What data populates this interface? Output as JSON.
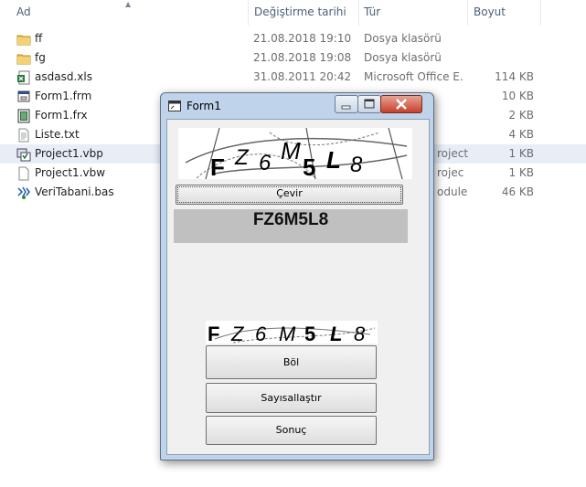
{
  "columns": {
    "name": "Ad",
    "date": "Değiştirme tarihi",
    "type": "Tür",
    "size": "Boyut"
  },
  "files": [
    {
      "icon": "folder-icon",
      "name": "ff",
      "date": "21.08.2018 19:10",
      "type": "Dosya klasörü",
      "size": ""
    },
    {
      "icon": "folder-icon",
      "name": "fg",
      "date": "21.08.2018 19:08",
      "type": "Dosya klasörü",
      "size": ""
    },
    {
      "icon": "excel-file-icon",
      "name": "asdasd.xls",
      "date": "31.08.2011 20:42",
      "type": "Microsoft Office E...",
      "size": "114 KB"
    },
    {
      "icon": "vb-form-icon",
      "name": "Form1.frm",
      "date": "",
      "type": "",
      "size": "10 KB"
    },
    {
      "icon": "vb-binary-icon",
      "name": "Form1.frx",
      "date": "",
      "type": "",
      "size": "2 KB"
    },
    {
      "icon": "text-file-icon",
      "name": "Liste.txt",
      "date": "",
      "type": "",
      "size": "4 KB"
    },
    {
      "icon": "vb-project-icon",
      "name": "Project1.vbp",
      "date": "",
      "type": "roject",
      "size": "1 KB"
    },
    {
      "icon": "blank-file-icon",
      "name": "Project1.vbw",
      "date": "",
      "type": "rojec",
      "size": "1 KB"
    },
    {
      "icon": "vb-module-icon",
      "name": "VeriTabani.bas",
      "date": "",
      "type": "odule",
      "size": "46 KB"
    }
  ],
  "form": {
    "title": "Form1",
    "captcha_chars": [
      "F",
      "Z",
      "6",
      "M",
      "5",
      "L",
      "8"
    ],
    "button_cevir": "Çevir",
    "result_text": "FZ6M5L8",
    "button_bol": "Böl",
    "button_sayisallastir": "Sayısallaştır",
    "button_sonuc": "Sonuç"
  }
}
